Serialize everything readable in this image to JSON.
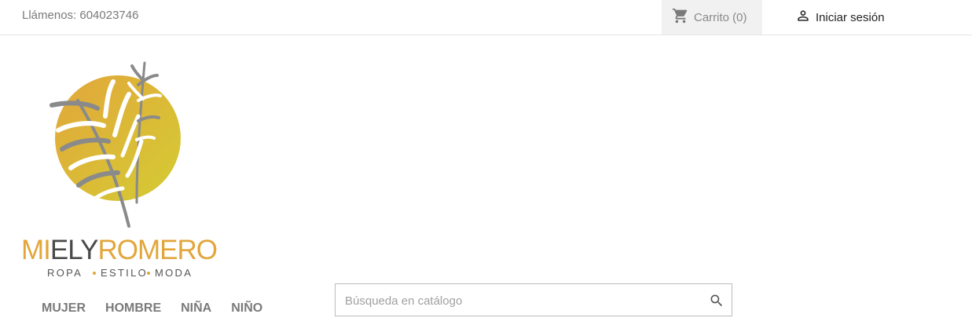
{
  "header": {
    "phone_text": "Llámenos: 604023746",
    "cart_label": "Carrito (0)",
    "login_label": "Iniciar sesión"
  },
  "logo": {
    "name_part1": "MI",
    "name_part2": "ELY",
    "name_part3": "ROMERO",
    "tagline_1": "ROPA",
    "tagline_2": "ESTILO",
    "tagline_3": "MODA",
    "colors": {
      "gold": "#e2a63b",
      "olive": "#d4c833",
      "gray": "#808080",
      "text_dark": "#4a4a4a"
    }
  },
  "nav": {
    "items": [
      "MUJER",
      "HOMBRE",
      "NIÑA",
      "NIÑO"
    ]
  },
  "search": {
    "placeholder": "Búsqueda en catálogo"
  },
  "icons": {
    "cart": "cart-icon",
    "user": "user-icon",
    "search": "search-icon"
  }
}
